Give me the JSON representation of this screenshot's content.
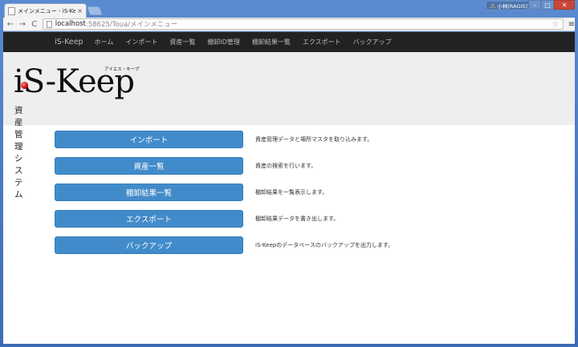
{
  "browser": {
    "tab_title": "メインメニュー - iS-Keep",
    "tab_close": "×",
    "user_badge": "小林[RAGIS]",
    "url_host": "localhost",
    "url_path": ":58625/Toua/メインメニュー",
    "back_icon": "←",
    "forward_icon": "→",
    "reload_icon": "C",
    "star_icon": "☆",
    "menu_icon": "≡",
    "minimize_glyph": "–",
    "maximize_glyph": "□",
    "close_glyph": "✕"
  },
  "navbar": {
    "brand": "iS-Keep",
    "items": [
      "ホーム",
      "インポート",
      "資産一覧",
      "棚卸ID管理",
      "棚卸結果一覧",
      "エクスポート",
      "バックアップ"
    ]
  },
  "header": {
    "logo_text": "iS-Keep",
    "logo_kana": "アイエス・キープ",
    "subtitle": "資産管理システム"
  },
  "menu": [
    {
      "label": "インポート",
      "description": "資産管理データと場所マスタを取り込みます。"
    },
    {
      "label": "資産一覧",
      "description": "資産の検索を行います。"
    },
    {
      "label": "棚卸結果一覧",
      "description": "棚卸結果を一覧表示します。"
    },
    {
      "label": "エクスポート",
      "description": "棚卸結果データを書き出します。"
    },
    {
      "label": "バックアップ",
      "description": "iS-Keepのデータベースのバックアップを出力します。"
    }
  ],
  "colors": {
    "button": "#428bca",
    "navbar": "#222222",
    "jumbotron": "#eeeeee",
    "logo_dot": "#d00000"
  }
}
